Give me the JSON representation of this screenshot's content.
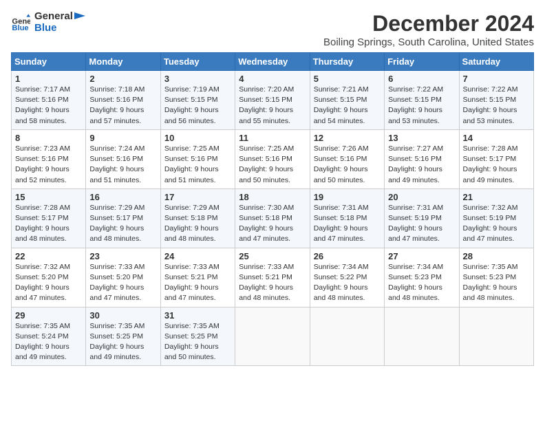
{
  "header": {
    "logo_line1": "General",
    "logo_line2": "Blue",
    "month": "December 2024",
    "location": "Boiling Springs, South Carolina, United States"
  },
  "weekdays": [
    "Sunday",
    "Monday",
    "Tuesday",
    "Wednesday",
    "Thursday",
    "Friday",
    "Saturday"
  ],
  "weeks": [
    [
      {
        "day": "1",
        "info": "Sunrise: 7:17 AM\nSunset: 5:16 PM\nDaylight: 9 hours\nand 58 minutes."
      },
      {
        "day": "2",
        "info": "Sunrise: 7:18 AM\nSunset: 5:16 PM\nDaylight: 9 hours\nand 57 minutes."
      },
      {
        "day": "3",
        "info": "Sunrise: 7:19 AM\nSunset: 5:15 PM\nDaylight: 9 hours\nand 56 minutes."
      },
      {
        "day": "4",
        "info": "Sunrise: 7:20 AM\nSunset: 5:15 PM\nDaylight: 9 hours\nand 55 minutes."
      },
      {
        "day": "5",
        "info": "Sunrise: 7:21 AM\nSunset: 5:15 PM\nDaylight: 9 hours\nand 54 minutes."
      },
      {
        "day": "6",
        "info": "Sunrise: 7:22 AM\nSunset: 5:15 PM\nDaylight: 9 hours\nand 53 minutes."
      },
      {
        "day": "7",
        "info": "Sunrise: 7:22 AM\nSunset: 5:15 PM\nDaylight: 9 hours\nand 53 minutes."
      }
    ],
    [
      {
        "day": "8",
        "info": "Sunrise: 7:23 AM\nSunset: 5:16 PM\nDaylight: 9 hours\nand 52 minutes."
      },
      {
        "day": "9",
        "info": "Sunrise: 7:24 AM\nSunset: 5:16 PM\nDaylight: 9 hours\nand 51 minutes."
      },
      {
        "day": "10",
        "info": "Sunrise: 7:25 AM\nSunset: 5:16 PM\nDaylight: 9 hours\nand 51 minutes."
      },
      {
        "day": "11",
        "info": "Sunrise: 7:25 AM\nSunset: 5:16 PM\nDaylight: 9 hours\nand 50 minutes."
      },
      {
        "day": "12",
        "info": "Sunrise: 7:26 AM\nSunset: 5:16 PM\nDaylight: 9 hours\nand 50 minutes."
      },
      {
        "day": "13",
        "info": "Sunrise: 7:27 AM\nSunset: 5:16 PM\nDaylight: 9 hours\nand 49 minutes."
      },
      {
        "day": "14",
        "info": "Sunrise: 7:28 AM\nSunset: 5:17 PM\nDaylight: 9 hours\nand 49 minutes."
      }
    ],
    [
      {
        "day": "15",
        "info": "Sunrise: 7:28 AM\nSunset: 5:17 PM\nDaylight: 9 hours\nand 48 minutes."
      },
      {
        "day": "16",
        "info": "Sunrise: 7:29 AM\nSunset: 5:17 PM\nDaylight: 9 hours\nand 48 minutes."
      },
      {
        "day": "17",
        "info": "Sunrise: 7:29 AM\nSunset: 5:18 PM\nDaylight: 9 hours\nand 48 minutes."
      },
      {
        "day": "18",
        "info": "Sunrise: 7:30 AM\nSunset: 5:18 PM\nDaylight: 9 hours\nand 47 minutes."
      },
      {
        "day": "19",
        "info": "Sunrise: 7:31 AM\nSunset: 5:18 PM\nDaylight: 9 hours\nand 47 minutes."
      },
      {
        "day": "20",
        "info": "Sunrise: 7:31 AM\nSunset: 5:19 PM\nDaylight: 9 hours\nand 47 minutes."
      },
      {
        "day": "21",
        "info": "Sunrise: 7:32 AM\nSunset: 5:19 PM\nDaylight: 9 hours\nand 47 minutes."
      }
    ],
    [
      {
        "day": "22",
        "info": "Sunrise: 7:32 AM\nSunset: 5:20 PM\nDaylight: 9 hours\nand 47 minutes."
      },
      {
        "day": "23",
        "info": "Sunrise: 7:33 AM\nSunset: 5:20 PM\nDaylight: 9 hours\nand 47 minutes."
      },
      {
        "day": "24",
        "info": "Sunrise: 7:33 AM\nSunset: 5:21 PM\nDaylight: 9 hours\nand 47 minutes."
      },
      {
        "day": "25",
        "info": "Sunrise: 7:33 AM\nSunset: 5:21 PM\nDaylight: 9 hours\nand 48 minutes."
      },
      {
        "day": "26",
        "info": "Sunrise: 7:34 AM\nSunset: 5:22 PM\nDaylight: 9 hours\nand 48 minutes."
      },
      {
        "day": "27",
        "info": "Sunrise: 7:34 AM\nSunset: 5:23 PM\nDaylight: 9 hours\nand 48 minutes."
      },
      {
        "day": "28",
        "info": "Sunrise: 7:35 AM\nSunset: 5:23 PM\nDaylight: 9 hours\nand 48 minutes."
      }
    ],
    [
      {
        "day": "29",
        "info": "Sunrise: 7:35 AM\nSunset: 5:24 PM\nDaylight: 9 hours\nand 49 minutes."
      },
      {
        "day": "30",
        "info": "Sunrise: 7:35 AM\nSunset: 5:25 PM\nDaylight: 9 hours\nand 49 minutes."
      },
      {
        "day": "31",
        "info": "Sunrise: 7:35 AM\nSunset: 5:25 PM\nDaylight: 9 hours\nand 50 minutes."
      },
      null,
      null,
      null,
      null
    ]
  ]
}
